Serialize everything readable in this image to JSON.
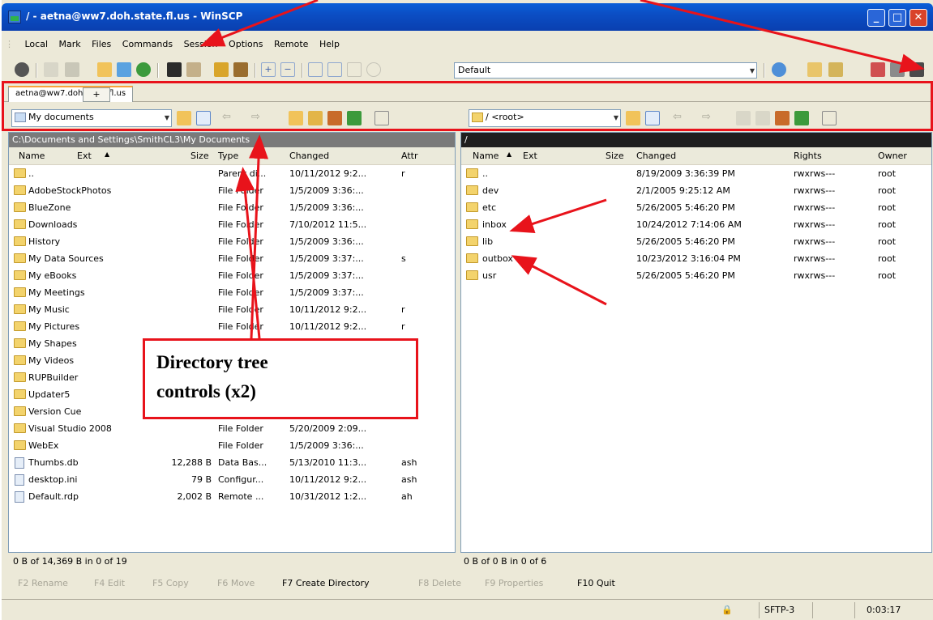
{
  "window": {
    "title": "/ - aetna@ww7.doh.state.fl.us - WinSCP"
  },
  "menu": [
    "Local",
    "Mark",
    "Files",
    "Commands",
    "Session",
    "Options",
    "Remote",
    "Help"
  ],
  "toolbar": {
    "transfer_profile": "Default"
  },
  "tabs": {
    "session": "aetna@ww7.doh.state.fl.us",
    "add": "+"
  },
  "left": {
    "location": "My documents",
    "path": "C:\\Documents and Settings\\SmithCL3\\My Documents",
    "columns": {
      "name": "Name",
      "ext": "Ext",
      "size": "Size",
      "type": "Type",
      "changed": "Changed",
      "attr": "Attr"
    },
    "rows": [
      {
        "name": "..",
        "size": "",
        "type": "Parent di...",
        "changed": "10/11/2012 9:2...",
        "attr": "r"
      },
      {
        "name": "AdobeStockPhotos",
        "size": "",
        "type": "File Folder",
        "changed": "1/5/2009 3:36:...",
        "attr": ""
      },
      {
        "name": "BlueZone",
        "size": "",
        "type": "File Folder",
        "changed": "1/5/2009 3:36:...",
        "attr": ""
      },
      {
        "name": "Downloads",
        "size": "",
        "type": "File Folder",
        "changed": "7/10/2012 11:5...",
        "attr": ""
      },
      {
        "name": "History",
        "size": "",
        "type": "File Folder",
        "changed": "1/5/2009 3:36:...",
        "attr": ""
      },
      {
        "name": "My Data Sources",
        "size": "",
        "type": "File Folder",
        "changed": "1/5/2009 3:37:...",
        "attr": "s"
      },
      {
        "name": "My eBooks",
        "size": "",
        "type": "File Folder",
        "changed": "1/5/2009 3:37:...",
        "attr": ""
      },
      {
        "name": "My Meetings",
        "size": "",
        "type": "File Folder",
        "changed": "1/5/2009 3:37:...",
        "attr": ""
      },
      {
        "name": "My Music",
        "size": "",
        "type": "File Folder",
        "changed": "10/11/2012 9:2...",
        "attr": "r"
      },
      {
        "name": "My Pictures",
        "size": "",
        "type": "File Folder",
        "changed": "10/11/2012 9:2...",
        "attr": "r"
      },
      {
        "name": "My Shapes",
        "size": "",
        "type": "",
        "changed": "",
        "attr": ""
      },
      {
        "name": "My Videos",
        "size": "",
        "type": "",
        "changed": "",
        "attr": ""
      },
      {
        "name": "RUPBuilder",
        "size": "",
        "type": "",
        "changed": "",
        "attr": ""
      },
      {
        "name": "Updater5",
        "size": "",
        "type": "",
        "changed": "",
        "attr": ""
      },
      {
        "name": "Version Cue",
        "size": "",
        "type": "File Folder",
        "changed": "1/5/2009 3:36:...",
        "attr": ""
      },
      {
        "name": "Visual Studio 2008",
        "size": "",
        "type": "File Folder",
        "changed": "5/20/2009 2:09...",
        "attr": ""
      },
      {
        "name": "WebEx",
        "size": "",
        "type": "File Folder",
        "changed": "1/5/2009 3:36:...",
        "attr": ""
      },
      {
        "name": "Thumbs.db",
        "size": "12,288 B",
        "type": "Data Bas...",
        "changed": "5/13/2010 11:3...",
        "attr": "ash"
      },
      {
        "name": "desktop.ini",
        "size": "79 B",
        "type": "Configur...",
        "changed": "10/11/2012 9:2...",
        "attr": "ash"
      },
      {
        "name": "Default.rdp",
        "size": "2,002 B",
        "type": "Remote ...",
        "changed": "10/31/2012 1:2...",
        "attr": "ah"
      }
    ],
    "status": "0 B of 14,369 B in 0 of 19"
  },
  "right": {
    "location": "/ <root>",
    "path": "/",
    "columns": {
      "name": "Name",
      "ext": "Ext",
      "size": "Size",
      "changed": "Changed",
      "rights": "Rights",
      "owner": "Owner"
    },
    "rows": [
      {
        "name": "..",
        "changed": "8/19/2009 3:36:39 PM",
        "rights": "rwxrws---",
        "owner": "root"
      },
      {
        "name": "dev",
        "changed": "2/1/2005 9:25:12 AM",
        "rights": "rwxrws---",
        "owner": "root"
      },
      {
        "name": "etc",
        "changed": "5/26/2005 5:46:20 PM",
        "rights": "rwxrws---",
        "owner": "root"
      },
      {
        "name": "inbox",
        "changed": "10/24/2012 7:14:06 AM",
        "rights": "rwxrws---",
        "owner": "root"
      },
      {
        "name": "lib",
        "changed": "5/26/2005 5:46:20 PM",
        "rights": "rwxrws---",
        "owner": "root"
      },
      {
        "name": "outbox",
        "changed": "10/23/2012 3:16:04 PM",
        "rights": "rwxrws---",
        "owner": "root"
      },
      {
        "name": "usr",
        "changed": "5/26/2005 5:46:20 PM",
        "rights": "rwxrws---",
        "owner": "root"
      }
    ],
    "status": "0 B of 0 B in 0 of 6"
  },
  "fkeys": [
    "F2 Rename",
    "F4 Edit",
    "F5 Copy",
    "F6 Move",
    "F7 Create Directory",
    "F8 Delete",
    "F9 Properties",
    "F10 Quit"
  ],
  "statusbar": {
    "protocol": "SFTP-3",
    "elapsed": "0:03:17"
  },
  "annotation": {
    "line1": "Directory tree",
    "line2": "controls (x2)"
  },
  "colors": {
    "annotation": "#e8131b",
    "title_bar": "#0b4ec4",
    "chrome": "#ece9d8"
  }
}
